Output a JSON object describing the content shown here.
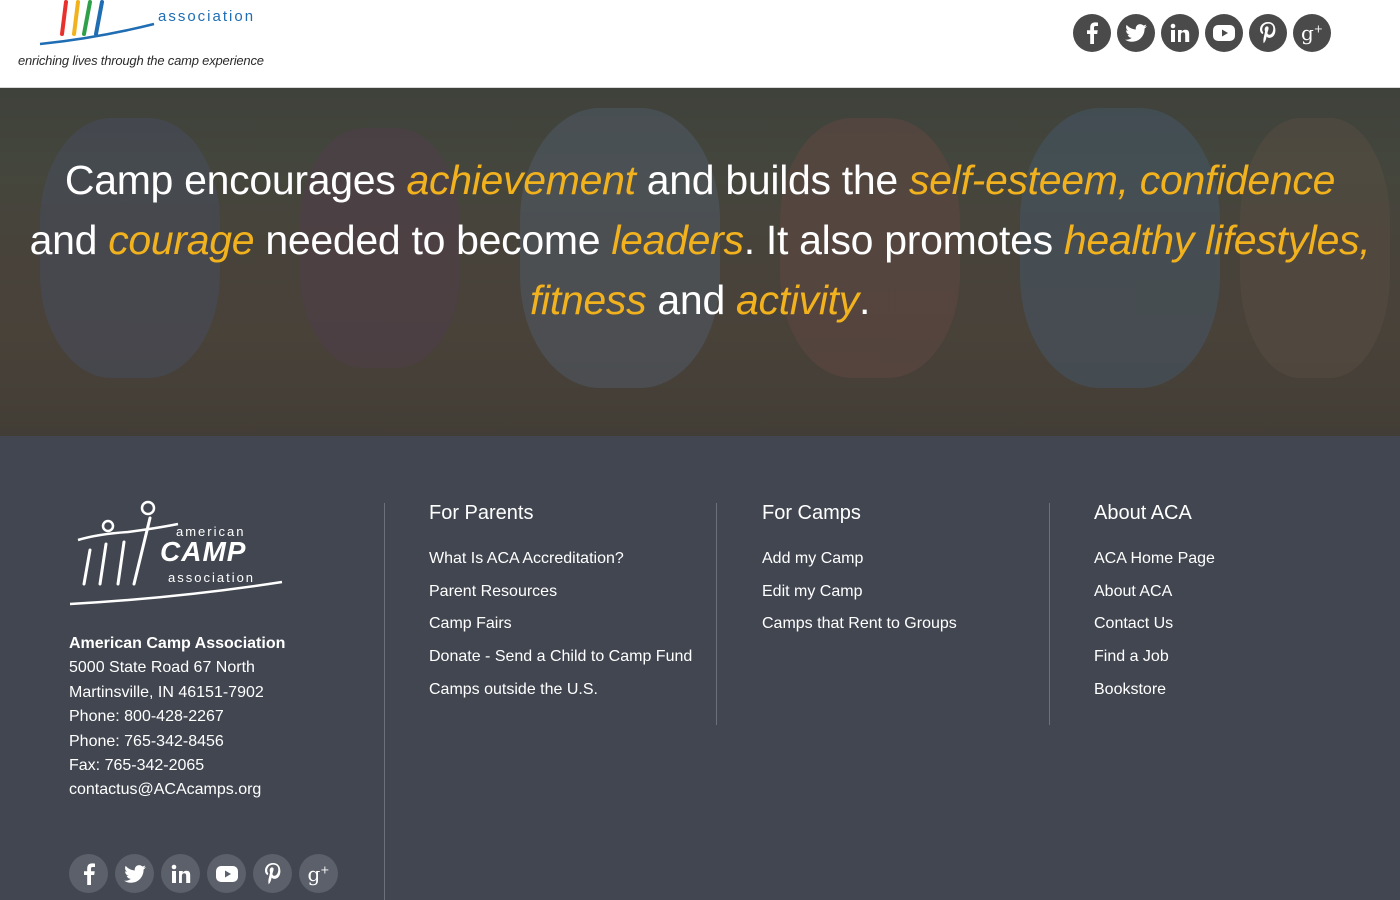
{
  "header": {
    "logo_assoc": "association",
    "tagline": "enriching lives through the camp experience",
    "social": [
      {
        "icon": "facebook-icon",
        "glyph": "f"
      },
      {
        "icon": "twitter-icon",
        "glyph": "t"
      },
      {
        "icon": "linkedin-icon",
        "glyph": "in"
      },
      {
        "icon": "youtube-icon",
        "glyph": "yt"
      },
      {
        "icon": "pinterest-icon",
        "glyph": "p"
      },
      {
        "icon": "googleplus-icon",
        "glyph": "g+"
      }
    ]
  },
  "hero": {
    "p1": "Camp encourages ",
    "h1": "achievement",
    "p2": " and builds the ",
    "h2": "self-esteem, confidence",
    "p3": " and ",
    "h3": "courage",
    "p4": " needed to become ",
    "h4": "leaders",
    "p5": ". It also promotes ",
    "h5": "healthy lifestyles, fitness",
    "p6": " and ",
    "h6": "activity",
    "p7": "."
  },
  "footer": {
    "logo_american": "american",
    "logo_camp": "CAMP",
    "logo_association": "association",
    "org_name": "American Camp Association",
    "address_1": "5000 State Road 67 North",
    "address_2": "Martinsville, IN 46151-7902",
    "phone_1": "Phone: 800-428-2267",
    "phone_2": "Phone: 765-342-8456",
    "fax": "Fax: 765-342-2065",
    "email": "contactus@ACAcamps.org",
    "columns": [
      {
        "title": "For Parents",
        "links": [
          "What Is ACA Accreditation?",
          "Parent Resources",
          "Camp Fairs",
          "Donate - Send a Child to Camp Fund",
          "Camps outside the U.S."
        ]
      },
      {
        "title": "For Camps",
        "links": [
          "Add my Camp",
          "Edit my Camp",
          "Camps that Rent to Groups"
        ]
      },
      {
        "title": "About ACA",
        "links": [
          "ACA Home Page",
          "About ACA",
          "Contact Us",
          "Find a Job",
          "Bookstore"
        ]
      }
    ]
  },
  "colors": {
    "highlight": "#f2b21e",
    "footer_bg": "#414650",
    "social_top_bg": "#4a4a4a"
  }
}
